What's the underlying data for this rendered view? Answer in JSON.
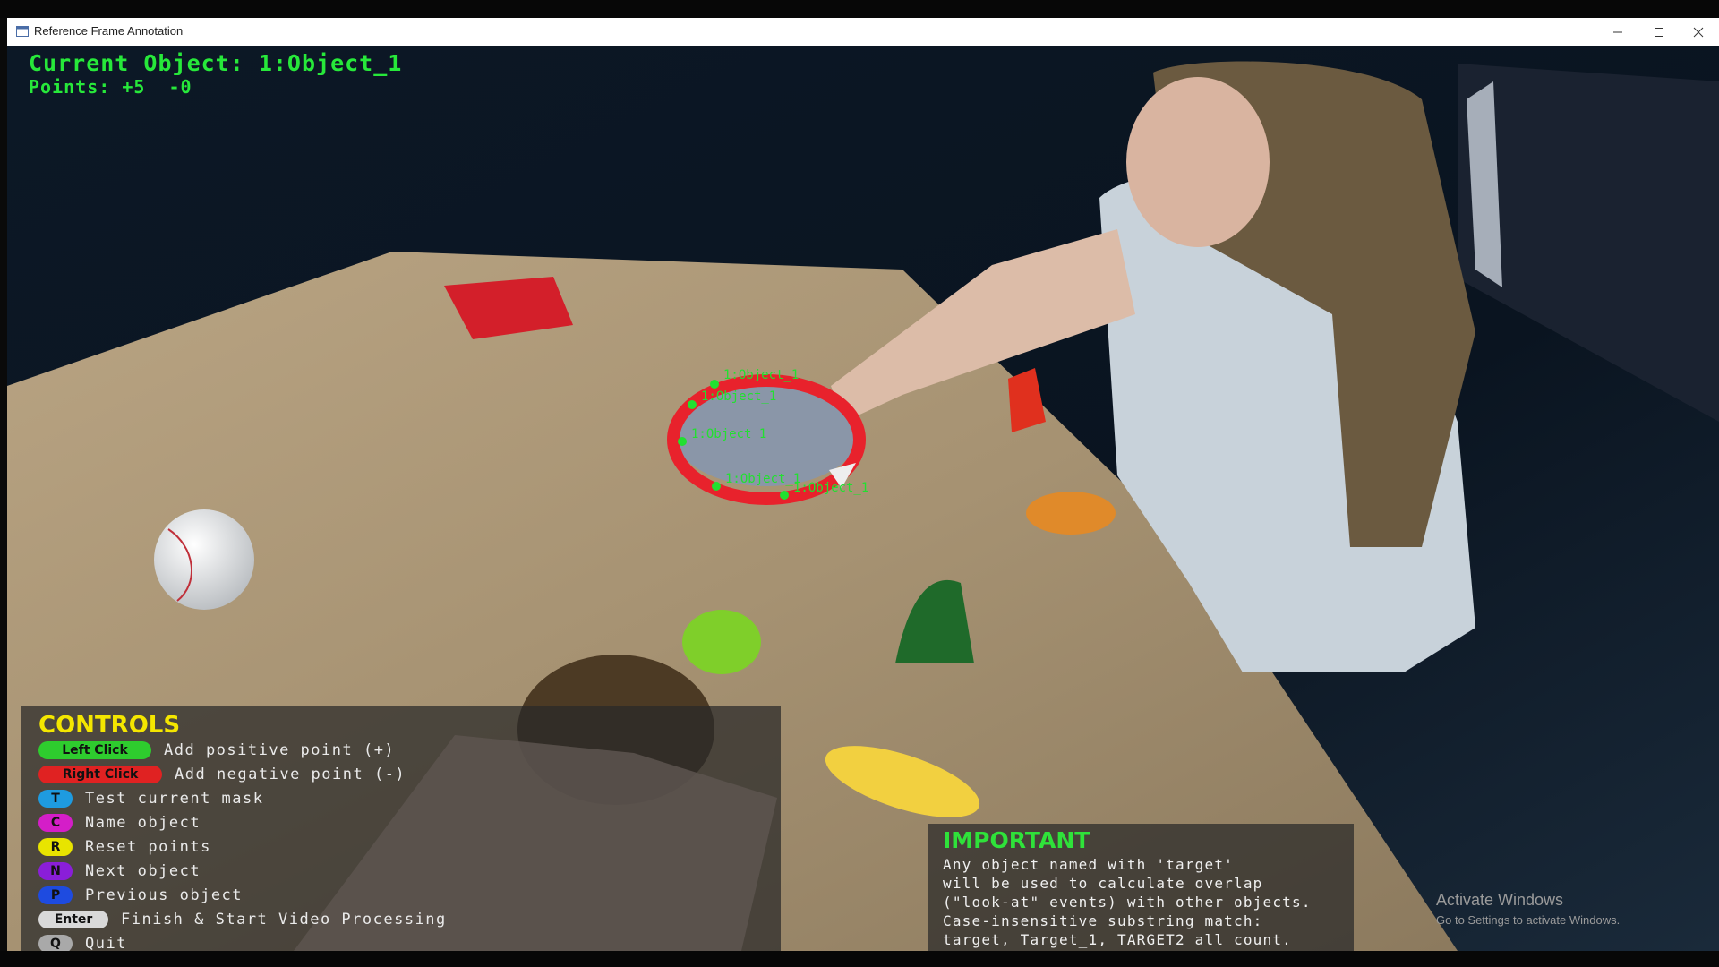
{
  "window": {
    "title": "Reference Frame Annotation",
    "controls": [
      "minimize-icon",
      "maximize-icon",
      "close-icon"
    ]
  },
  "hud": {
    "current_object_label": "Current Object: 1:Object_1",
    "points_label": "Points: +5  -0"
  },
  "point_labels": [
    "1:Object_1",
    "1:Object_1",
    "1:Object_1",
    "1:Object_1",
    "1:Object_1"
  ],
  "controls": {
    "title": "CONTROLS",
    "items": [
      {
        "key": "Left Click",
        "desc": "Add positive point (+)",
        "color": "#2ecc2e"
      },
      {
        "key": "Right Click",
        "desc": "Add negative point (-)",
        "color": "#e02222"
      },
      {
        "key": "T",
        "desc": "Test current mask",
        "color": "#1e9be0"
      },
      {
        "key": "C",
        "desc": "Name object",
        "color": "#d41ec8"
      },
      {
        "key": "R",
        "desc": "Reset points",
        "color": "#e8e400"
      },
      {
        "key": "N",
        "desc": "Next object",
        "color": "#8a1ed8"
      },
      {
        "key": "P",
        "desc": "Previous object",
        "color": "#1e4be0"
      },
      {
        "key": "Enter",
        "desc": "Finish & Start Video Processing",
        "color": "#d9d9d9"
      },
      {
        "key": "Q",
        "desc": "Quit",
        "color": "#a9a9a9"
      }
    ]
  },
  "important": {
    "title": "IMPORTANT",
    "lines": [
      "Any object named with 'target'",
      "will be used to calculate overlap",
      "(\"look-at\" events) with other objects.",
      "Case-insensitive substring match:",
      "target, Target_1, TARGET2 all count."
    ]
  },
  "watermark": {
    "title": "Activate Windows",
    "subtitle": "Go to Settings to activate Windows."
  },
  "colors": {
    "hud_green": "#27e83a",
    "controls_title": "#f4e600",
    "important_title": "#2fe23a",
    "mask_ring": "#e8222c"
  }
}
